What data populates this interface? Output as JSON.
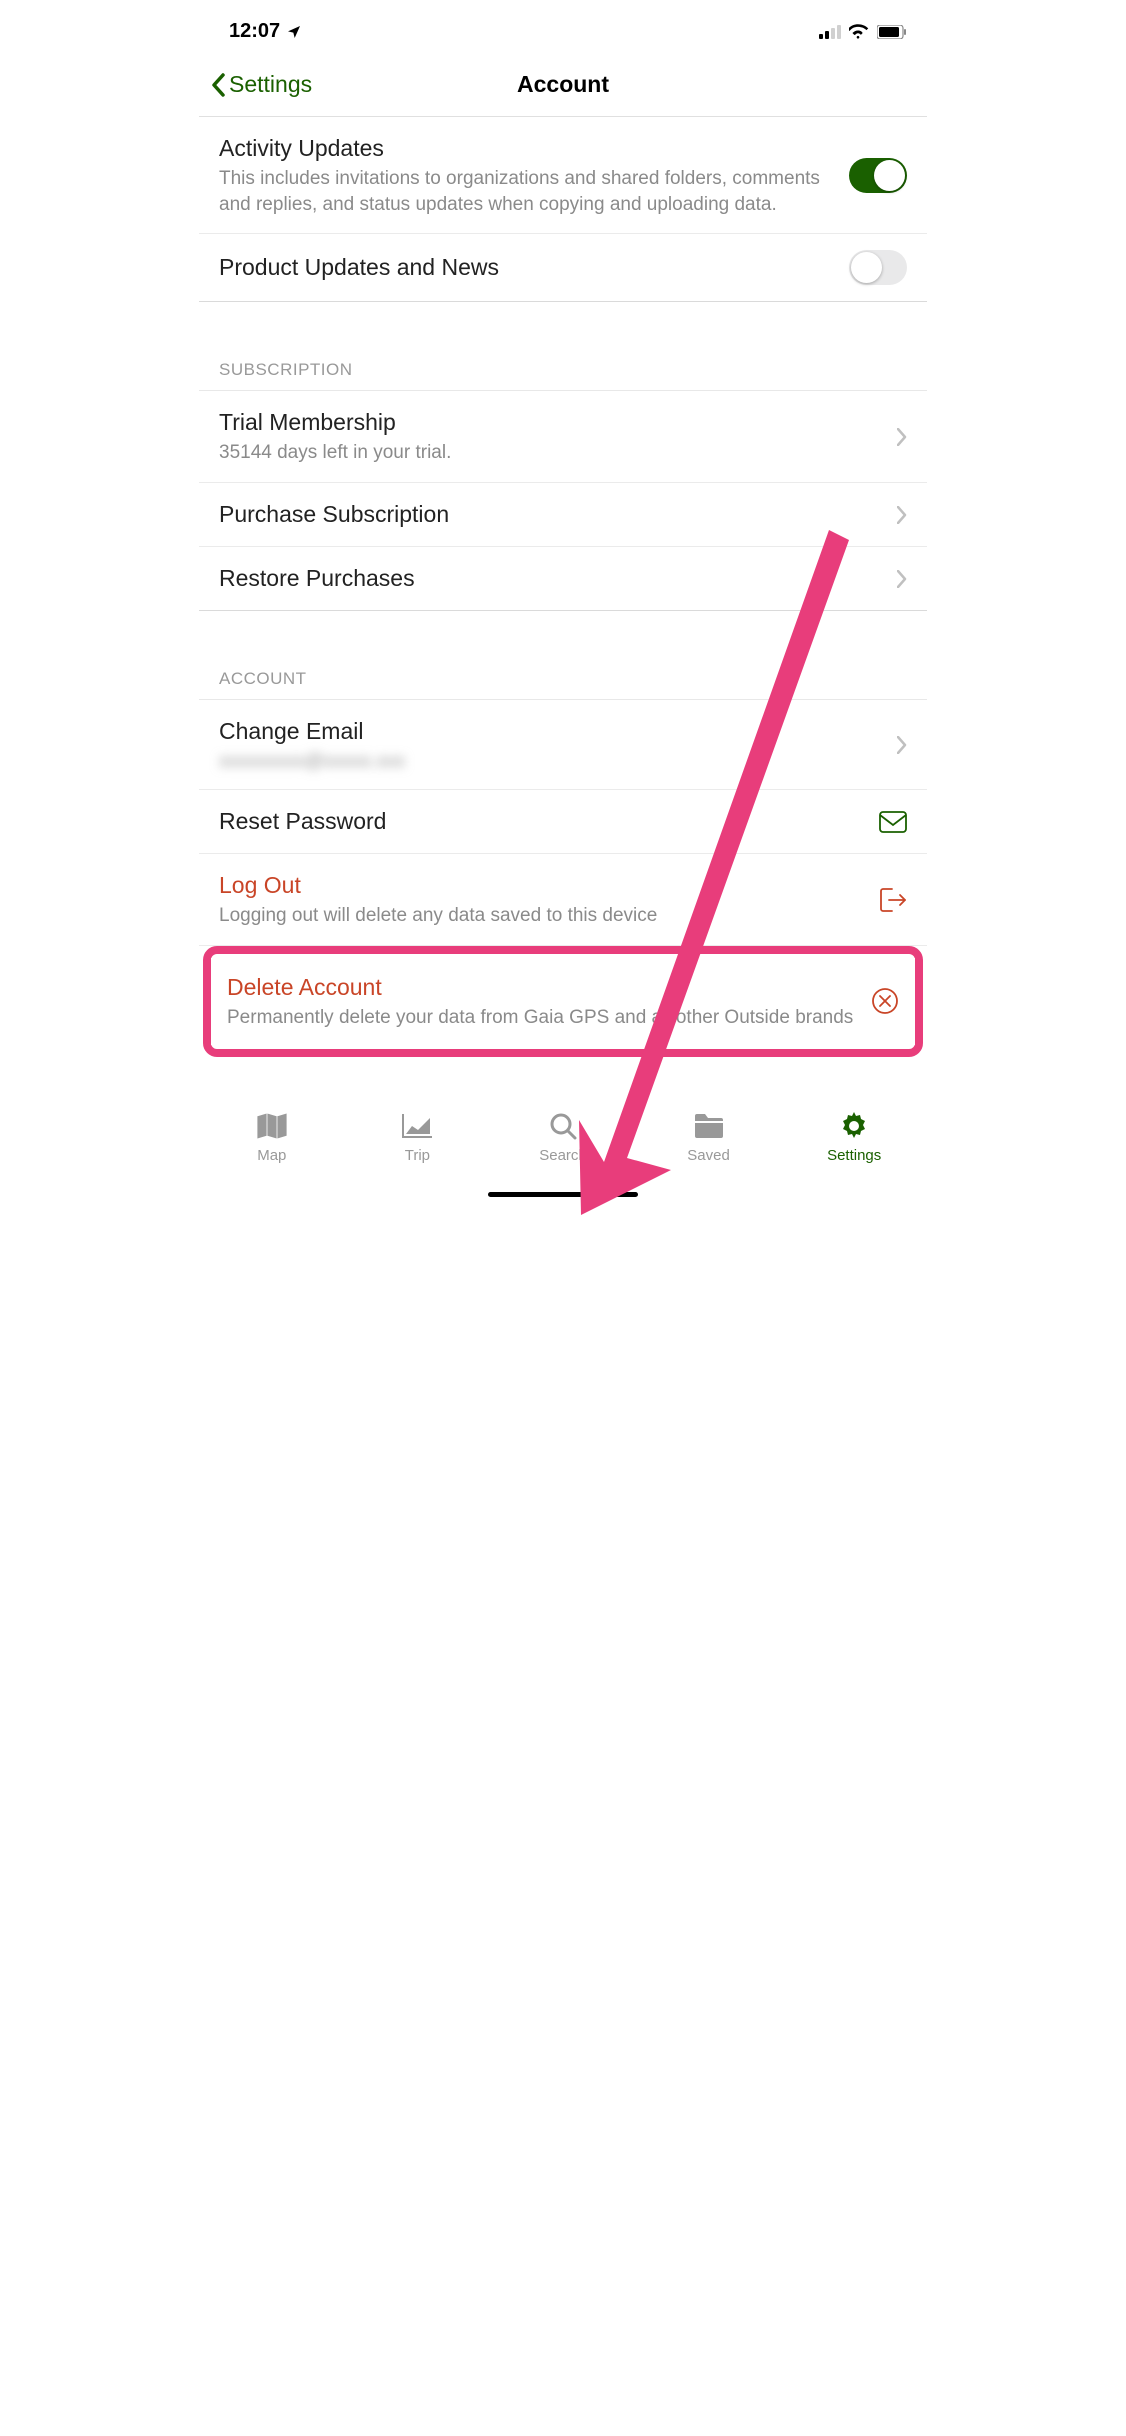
{
  "status": {
    "time": "12:07"
  },
  "nav": {
    "back": "Settings",
    "title": "Account"
  },
  "updates": {
    "activity_title": "Activity Updates",
    "activity_sub": "This includes invitations to organizations and shared folders, comments and replies, and status updates when copying and uploading data.",
    "product_title": "Product Updates and News"
  },
  "subscription": {
    "header": "Subscription",
    "trial_title": "Trial Membership",
    "trial_sub": "35144 days left in your trial.",
    "purchase": "Purchase Subscription",
    "restore": "Restore Purchases"
  },
  "account": {
    "header": "Account",
    "change_email": "Change Email",
    "email_value": "xxxxxxxxx@xxxxx.xxx",
    "reset_password": "Reset Password",
    "logout_title": "Log Out",
    "logout_sub": "Logging out will delete any data saved to this device",
    "delete_title": "Delete Account",
    "delete_sub": "Permanently delete your data from Gaia GPS and all other Outside brands"
  },
  "tabs": {
    "map": "Map",
    "trip": "Trip",
    "search": "Search",
    "saved": "Saved",
    "settings": "Settings"
  }
}
